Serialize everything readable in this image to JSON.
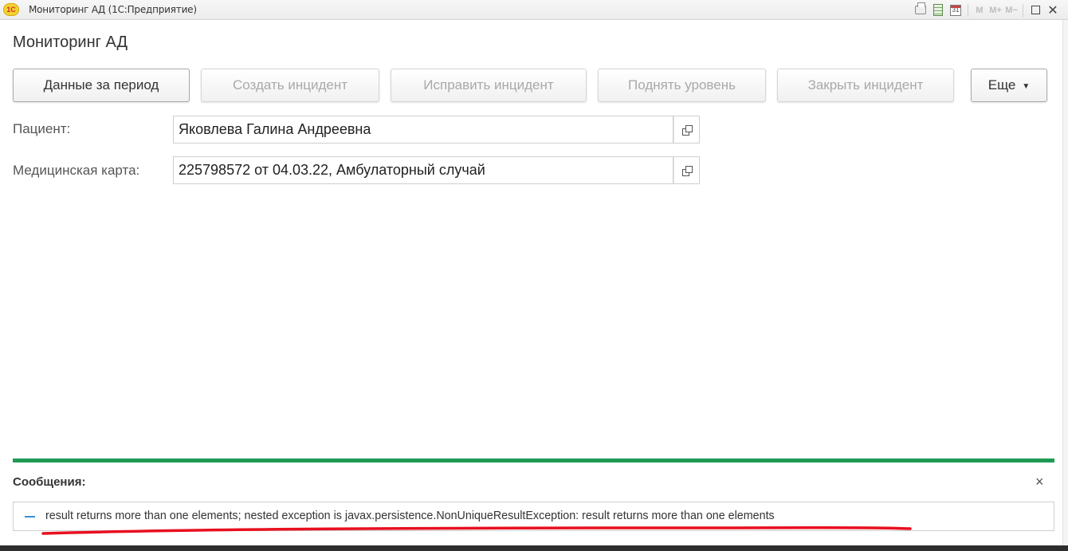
{
  "window": {
    "title": "Мониторинг АД  (1С:Предприятие)",
    "logo_text": "1С",
    "toolbar_icons": [
      "printer-icon",
      "calculator-icon",
      "calendar-icon",
      "M",
      "M+",
      "M−",
      "maximize-icon",
      "close-icon"
    ],
    "calendar_day": "31",
    "m_label": "M",
    "mplus_label": "M+",
    "mminus_label": "M−",
    "close_glyph": "✕"
  },
  "page": {
    "title": "Мониторинг АД"
  },
  "toolbar": {
    "buttons": [
      {
        "label": "Данные за период",
        "enabled": true
      },
      {
        "label": "Создать инцидент",
        "enabled": false
      },
      {
        "label": "Исправить инцидент",
        "enabled": false
      },
      {
        "label": "Поднять уровень",
        "enabled": false
      },
      {
        "label": "Закрыть инцидент",
        "enabled": false
      },
      {
        "label": "Еще",
        "enabled": true,
        "has_dropdown": true
      }
    ],
    "more_caret": "▼"
  },
  "fields": {
    "patient": {
      "label": "Пациент:",
      "value": "Яковлева Галина Андреевна"
    },
    "medcard": {
      "label": "Медицинская карта:",
      "value": "225798572 от 04.03.22, Амбулаторный случай"
    }
  },
  "messages": {
    "title": "Сообщения:",
    "close_glyph": "×",
    "items": [
      {
        "text": "result returns more than one elements; nested exception is javax.persistence.NonUniqueResultException: result returns more than one elements"
      }
    ]
  },
  "colors": {
    "messages_separator": "#1f9a55",
    "annotation_underline": "#e8101f",
    "message_marker": "#3a8fd6",
    "disabled_text": "#a9a9a9"
  }
}
